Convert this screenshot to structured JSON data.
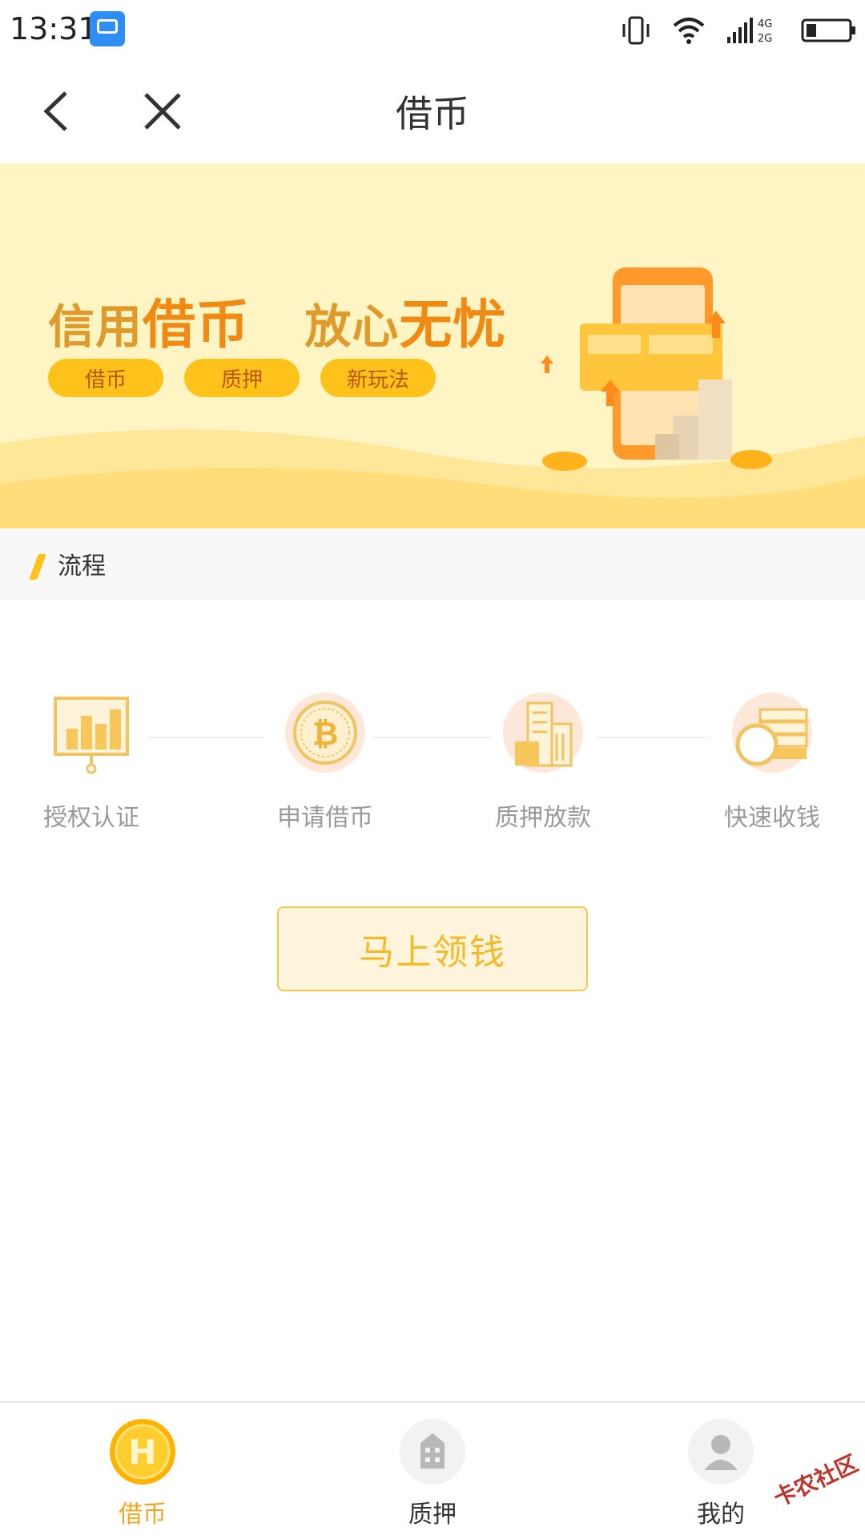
{
  "status_bar": {
    "time": "13:31",
    "network": "4G\n2G"
  },
  "nav": {
    "title": "借币"
  },
  "banner": {
    "headline_part1": "信用",
    "headline_big1": "借币",
    "headline_part2": "放心",
    "headline_big2": "无忧",
    "chips": [
      "借币",
      "质押",
      "新玩法"
    ]
  },
  "section": {
    "title": "流程"
  },
  "steps": [
    {
      "label": "授权认证",
      "icon": "chart-board-icon"
    },
    {
      "label": "申请借币",
      "icon": "bitcoin-icon"
    },
    {
      "label": "质押放款",
      "icon": "building-icon"
    },
    {
      "label": "快速收钱",
      "icon": "coin-stack-icon"
    }
  ],
  "cta": {
    "label": "马上领钱"
  },
  "tabbar": {
    "items": [
      {
        "label": "借币",
        "icon": "coin-h-icon",
        "active": true
      },
      {
        "label": "质押",
        "icon": "building-icon",
        "active": false
      },
      {
        "label": "我的",
        "icon": "user-icon",
        "active": false
      }
    ]
  },
  "watermark": "卡农社区",
  "colors": {
    "accent": "#f5a623",
    "banner_bg": "#fff4c4",
    "chip": "#ffc21a"
  }
}
